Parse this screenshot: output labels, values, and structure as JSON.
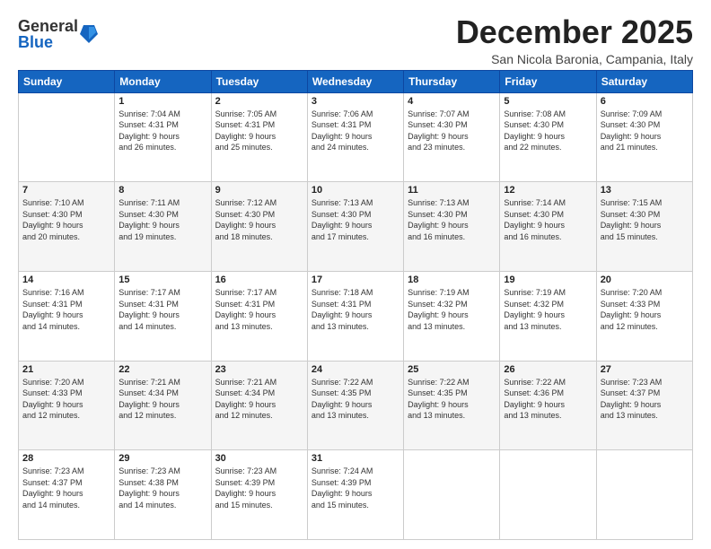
{
  "logo": {
    "general": "General",
    "blue": "Blue"
  },
  "header": {
    "month": "December 2025",
    "location": "San Nicola Baronia, Campania, Italy"
  },
  "weekdays": [
    "Sunday",
    "Monday",
    "Tuesday",
    "Wednesday",
    "Thursday",
    "Friday",
    "Saturday"
  ],
  "days": {
    "1": {
      "sunrise": "7:04 AM",
      "sunset": "4:31 PM",
      "daylight": "9 hours and 26 minutes."
    },
    "2": {
      "sunrise": "7:05 AM",
      "sunset": "4:31 PM",
      "daylight": "9 hours and 25 minutes."
    },
    "3": {
      "sunrise": "7:06 AM",
      "sunset": "4:31 PM",
      "daylight": "9 hours and 24 minutes."
    },
    "4": {
      "sunrise": "7:07 AM",
      "sunset": "4:30 PM",
      "daylight": "9 hours and 23 minutes."
    },
    "5": {
      "sunrise": "7:08 AM",
      "sunset": "4:30 PM",
      "daylight": "9 hours and 22 minutes."
    },
    "6": {
      "sunrise": "7:09 AM",
      "sunset": "4:30 PM",
      "daylight": "9 hours and 21 minutes."
    },
    "7": {
      "sunrise": "7:10 AM",
      "sunset": "4:30 PM",
      "daylight": "9 hours and 20 minutes."
    },
    "8": {
      "sunrise": "7:11 AM",
      "sunset": "4:30 PM",
      "daylight": "9 hours and 19 minutes."
    },
    "9": {
      "sunrise": "7:12 AM",
      "sunset": "4:30 PM",
      "daylight": "9 hours and 18 minutes."
    },
    "10": {
      "sunrise": "7:13 AM",
      "sunset": "4:30 PM",
      "daylight": "9 hours and 17 minutes."
    },
    "11": {
      "sunrise": "7:13 AM",
      "sunset": "4:30 PM",
      "daylight": "9 hours and 16 minutes."
    },
    "12": {
      "sunrise": "7:14 AM",
      "sunset": "4:30 PM",
      "daylight": "9 hours and 16 minutes."
    },
    "13": {
      "sunrise": "7:15 AM",
      "sunset": "4:30 PM",
      "daylight": "9 hours and 15 minutes."
    },
    "14": {
      "sunrise": "7:16 AM",
      "sunset": "4:31 PM",
      "daylight": "9 hours and 14 minutes."
    },
    "15": {
      "sunrise": "7:17 AM",
      "sunset": "4:31 PM",
      "daylight": "9 hours and 14 minutes."
    },
    "16": {
      "sunrise": "7:17 AM",
      "sunset": "4:31 PM",
      "daylight": "9 hours and 13 minutes."
    },
    "17": {
      "sunrise": "7:18 AM",
      "sunset": "4:31 PM",
      "daylight": "9 hours and 13 minutes."
    },
    "18": {
      "sunrise": "7:19 AM",
      "sunset": "4:32 PM",
      "daylight": "9 hours and 13 minutes."
    },
    "19": {
      "sunrise": "7:19 AM",
      "sunset": "4:32 PM",
      "daylight": "9 hours and 13 minutes."
    },
    "20": {
      "sunrise": "7:20 AM",
      "sunset": "4:33 PM",
      "daylight": "9 hours and 12 minutes."
    },
    "21": {
      "sunrise": "7:20 AM",
      "sunset": "4:33 PM",
      "daylight": "9 hours and 12 minutes."
    },
    "22": {
      "sunrise": "7:21 AM",
      "sunset": "4:34 PM",
      "daylight": "9 hours and 12 minutes."
    },
    "23": {
      "sunrise": "7:21 AM",
      "sunset": "4:34 PM",
      "daylight": "9 hours and 12 minutes."
    },
    "24": {
      "sunrise": "7:22 AM",
      "sunset": "4:35 PM",
      "daylight": "9 hours and 13 minutes."
    },
    "25": {
      "sunrise": "7:22 AM",
      "sunset": "4:35 PM",
      "daylight": "9 hours and 13 minutes."
    },
    "26": {
      "sunrise": "7:22 AM",
      "sunset": "4:36 PM",
      "daylight": "9 hours and 13 minutes."
    },
    "27": {
      "sunrise": "7:23 AM",
      "sunset": "4:37 PM",
      "daylight": "9 hours and 13 minutes."
    },
    "28": {
      "sunrise": "7:23 AM",
      "sunset": "4:37 PM",
      "daylight": "9 hours and 14 minutes."
    },
    "29": {
      "sunrise": "7:23 AM",
      "sunset": "4:38 PM",
      "daylight": "9 hours and 14 minutes."
    },
    "30": {
      "sunrise": "7:23 AM",
      "sunset": "4:39 PM",
      "daylight": "9 hours and 15 minutes."
    },
    "31": {
      "sunrise": "7:24 AM",
      "sunset": "4:39 PM",
      "daylight": "9 hours and 15 minutes."
    }
  },
  "labels": {
    "sunrise": "Sunrise:",
    "sunset": "Sunset:",
    "daylight": "Daylight:"
  }
}
